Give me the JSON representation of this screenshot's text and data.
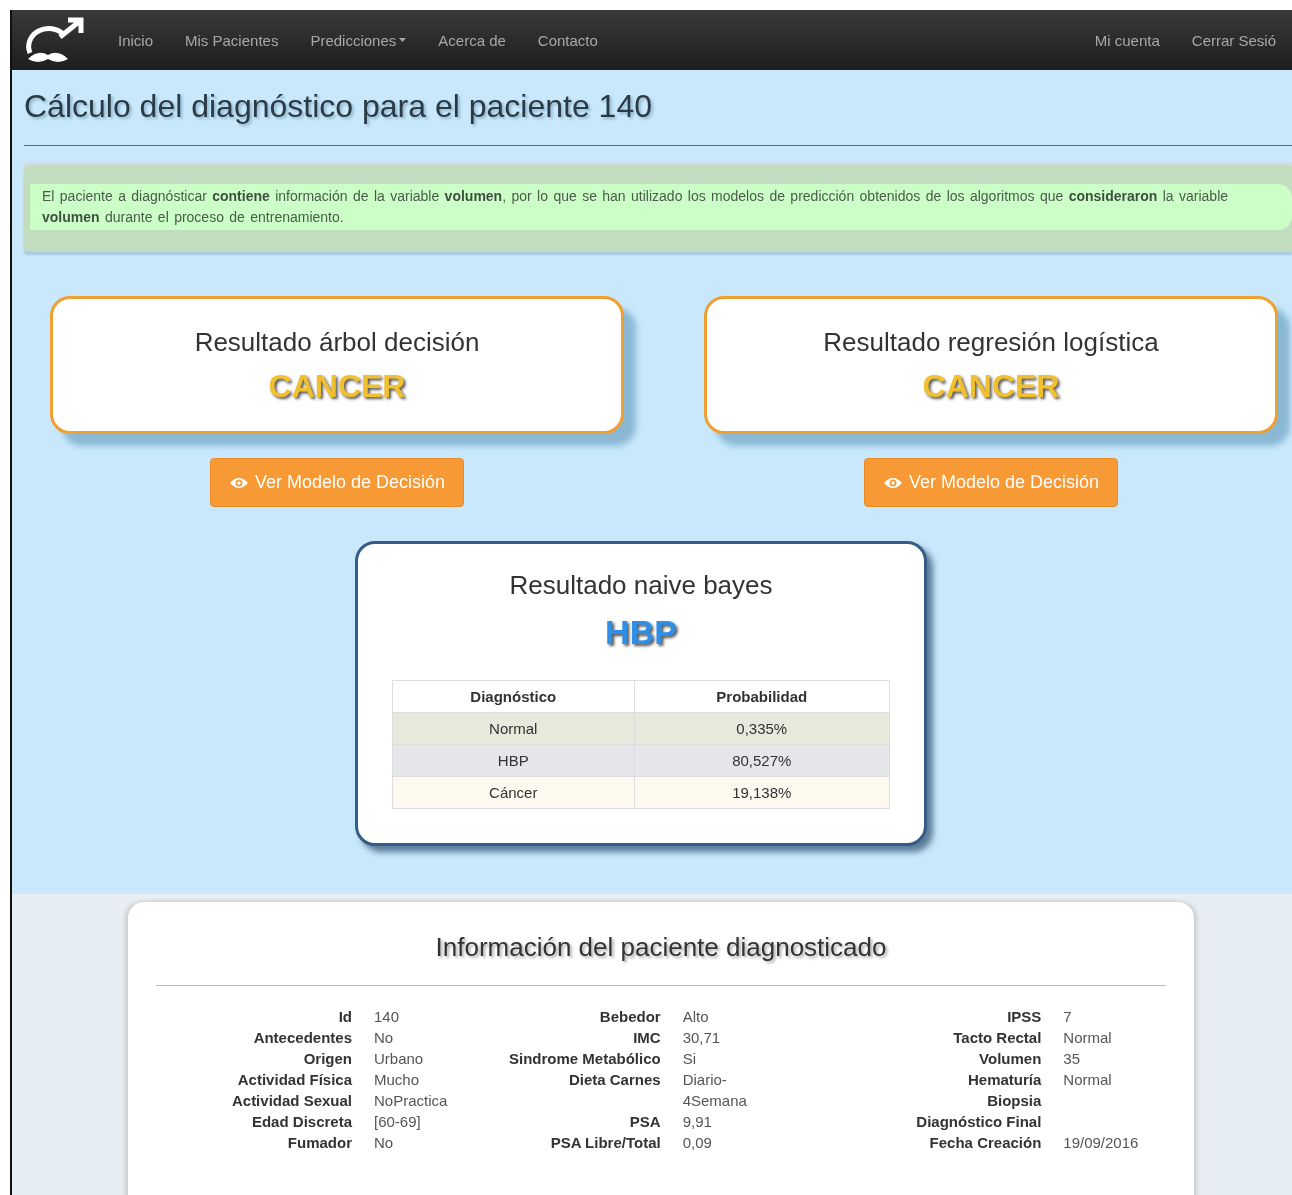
{
  "navbar": {
    "left": [
      {
        "label": "Inicio",
        "dropdown": false
      },
      {
        "label": "Mis Pacientes",
        "dropdown": false
      },
      {
        "label": "Predicciones",
        "dropdown": true
      },
      {
        "label": "Acerca de",
        "dropdown": false
      },
      {
        "label": "Contacto",
        "dropdown": false
      }
    ],
    "right": [
      {
        "label": "Mi cuenta"
      },
      {
        "label": "Cerrar Sesió"
      }
    ]
  },
  "page_title": "Cálculo del diagnóstico para el paciente 140",
  "alert": "El paciente a diagnósticar **contiene** información de la variable **volumen**, por lo que se han utilizado los modelos de predicción obtenidos de los algoritmos que **consideraron** la variable **volumen** durante el proceso de entrenamiento.",
  "results": [
    {
      "title": "Resultado árbol decisión",
      "result": "CANCER",
      "color": "#f0c030",
      "button": "Ver Modelo de Decisión"
    },
    {
      "title": "Resultado regresión logística",
      "result": "CANCER",
      "color": "#f0c030",
      "button": "Ver Modelo de Decisión"
    }
  ],
  "naive_bayes": {
    "title": "Resultado naive bayes",
    "result": "HBP",
    "color": "#2f8fe6",
    "table": {
      "columns": [
        "Diagnóstico",
        "Probabilidad"
      ],
      "rows": [
        {
          "cells": [
            "Normal",
            "0,335%"
          ],
          "color": "#e6e9dc"
        },
        {
          "cells": [
            "HBP",
            "80,527%"
          ],
          "color": "#e4e6ea"
        },
        {
          "cells": [
            "Cáncer",
            "19,138%"
          ],
          "color": "#fdf9ee"
        }
      ]
    }
  },
  "patient_info": {
    "title": "Información del paciente diagnosticado",
    "columns": [
      [
        {
          "label": "Id",
          "value": "140"
        },
        {
          "label": "Antecedentes",
          "value": "No"
        },
        {
          "label": "Origen",
          "value": "Urbano"
        },
        {
          "label": "Actividad Física",
          "value": "Mucho"
        },
        {
          "label": "Actividad Sexual",
          "value": "NoPractica"
        },
        {
          "label": "Edad Discreta",
          "value": "[60-69]"
        },
        {
          "label": "Fumador",
          "value": "No"
        }
      ],
      [
        {
          "label": "Bebedor",
          "value": "Alto"
        },
        {
          "label": "IMC",
          "value": "30,71"
        },
        {
          "label": "Sindrome Metabólico",
          "value": "Si"
        },
        {
          "label": "Dieta Carnes",
          "value": "Diario-4Semana"
        },
        {
          "label": "PSA",
          "value": "9,91"
        },
        {
          "label": "PSA Libre/Total",
          "value": "0,09"
        }
      ],
      [
        {
          "label": "IPSS",
          "value": "7"
        },
        {
          "label": "Tacto Rectal",
          "value": "Normal"
        },
        {
          "label": "Volumen",
          "value": "35"
        },
        {
          "label": "Hematuría",
          "value": "Normal"
        },
        {
          "label": "Biopsia"
        },
        {
          "label": "Diagnóstico Final"
        },
        {
          "label": "Fecha Creación",
          "value": "19/09/2016"
        }
      ]
    ]
  }
}
